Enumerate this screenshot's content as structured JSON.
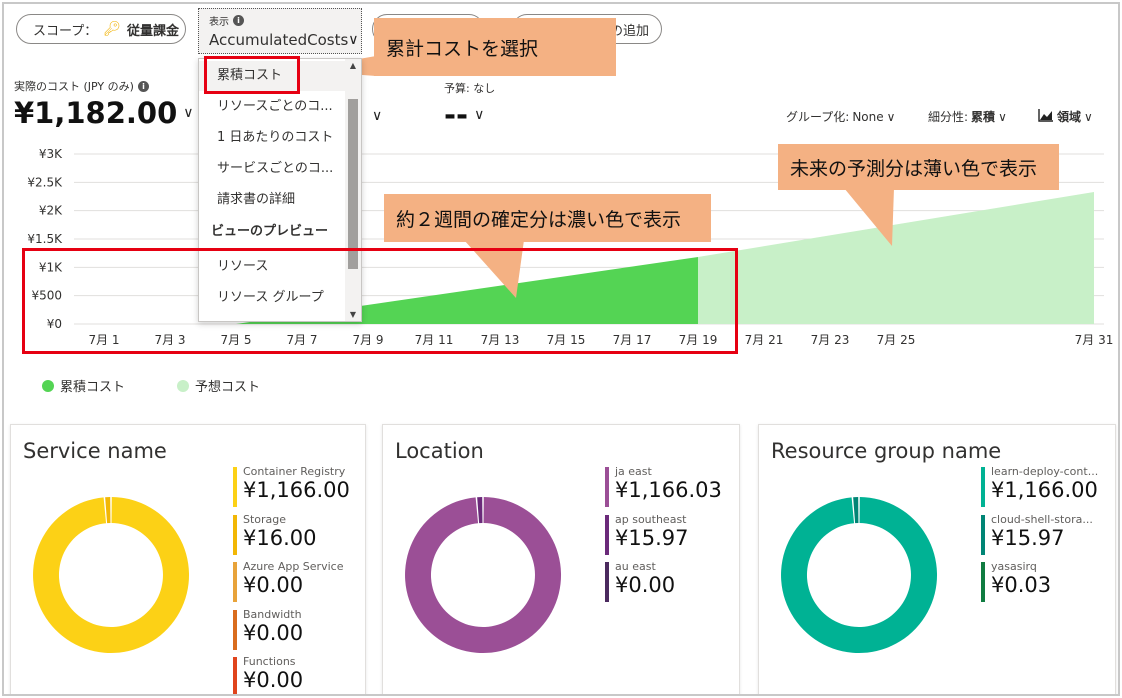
{
  "toolbar": {
    "scope_label": "スコープ：",
    "scope_value": "従量課金",
    "view_label": "表示",
    "view_value": "AccumulatedCosts",
    "add_filter_label": "の追加"
  },
  "view_menu": {
    "items": [
      {
        "label": "累積コスト",
        "selected": true
      },
      {
        "label": "リソースごとのコ..."
      },
      {
        "label": "1 日あたりのコスト"
      },
      {
        "label": "サービスごとのコ..."
      },
      {
        "label": "請求書の詳細"
      },
      {
        "label": "ビューのプレビュー",
        "header": true
      },
      {
        "label": "リソース"
      },
      {
        "label": "リソース グループ"
      }
    ]
  },
  "kpis": {
    "actual_label": "実際のコスト (JPY のみ)",
    "actual_value": "¥1,182.00",
    "budget_label": "予算: なし",
    "budget_value": "--"
  },
  "controls": {
    "group_label": "グループ化:",
    "group_value": "None",
    "granularity_label": "細分性:",
    "granularity_value": "累積",
    "chart_type_value": "領域"
  },
  "chart_data": {
    "type": "area",
    "y_ticks": [
      "¥3K",
      "¥2.5K",
      "¥2K",
      "¥1.5K",
      "¥1K",
      "¥500",
      "¥0"
    ],
    "ylim": [
      0,
      3000
    ],
    "x_ticks": [
      "7月 1",
      "7月 3",
      "7月 5",
      "7月 7",
      "7月 9",
      "7月 11",
      "7月 13",
      "7月 15",
      "7月 17",
      "7月 19",
      "7月 21",
      "7月 23",
      "7月 25",
      "7月 31"
    ],
    "x_tick_days": [
      1,
      3,
      5,
      7,
      9,
      11,
      13,
      15,
      17,
      19,
      21,
      23,
      25,
      31
    ],
    "series": [
      {
        "name": "累積コスト",
        "color": "#54d454",
        "x": [
          5,
          19
        ],
        "y": [
          0,
          1182
        ]
      },
      {
        "name": "予想コスト",
        "color": "#c8f0c8",
        "x": [
          19,
          31
        ],
        "y": [
          1182,
          2330
        ]
      }
    ]
  },
  "callouts": {
    "select": "累計コストを選択",
    "actual": "約２週間の確定分は濃い色で表示",
    "forecast": "未来の予測分は薄い色で表示"
  },
  "cards": [
    {
      "title": "Service name",
      "items": [
        {
          "name": "Container Registry",
          "amount": "¥1,166.00",
          "value": 1166,
          "color": "#fcd116"
        },
        {
          "name": "Storage",
          "amount": "¥16.00",
          "value": 16,
          "color": "#f2b705"
        },
        {
          "name": "Azure App Service",
          "amount": "¥0.00",
          "value": 0,
          "color": "#e8a33a"
        },
        {
          "name": "Bandwidth",
          "amount": "¥0.00",
          "value": 0,
          "color": "#d96c1d"
        },
        {
          "name": "Functions",
          "amount": "¥0.00",
          "value": 0,
          "color": "#e0441c"
        }
      ]
    },
    {
      "title": "Location",
      "items": [
        {
          "name": "ja east",
          "amount": "¥1,166.03",
          "value": 1166.03,
          "color": "#9b4f96"
        },
        {
          "name": "ap southeast",
          "amount": "¥15.97",
          "value": 15.97,
          "color": "#6b2a7a"
        },
        {
          "name": "au east",
          "amount": "¥0.00",
          "value": 0,
          "color": "#4b2a5e"
        }
      ]
    },
    {
      "title": "Resource group name",
      "items": [
        {
          "name": "learn-deploy-cont...",
          "amount": "¥1,166.00",
          "value": 1166,
          "color": "#00b294"
        },
        {
          "name": "cloud-shell-stora...",
          "amount": "¥15.97",
          "value": 15.97,
          "color": "#008575"
        },
        {
          "name": "yasasirq",
          "amount": "¥0.03",
          "value": 0.03,
          "color": "#107c41"
        }
      ]
    }
  ]
}
